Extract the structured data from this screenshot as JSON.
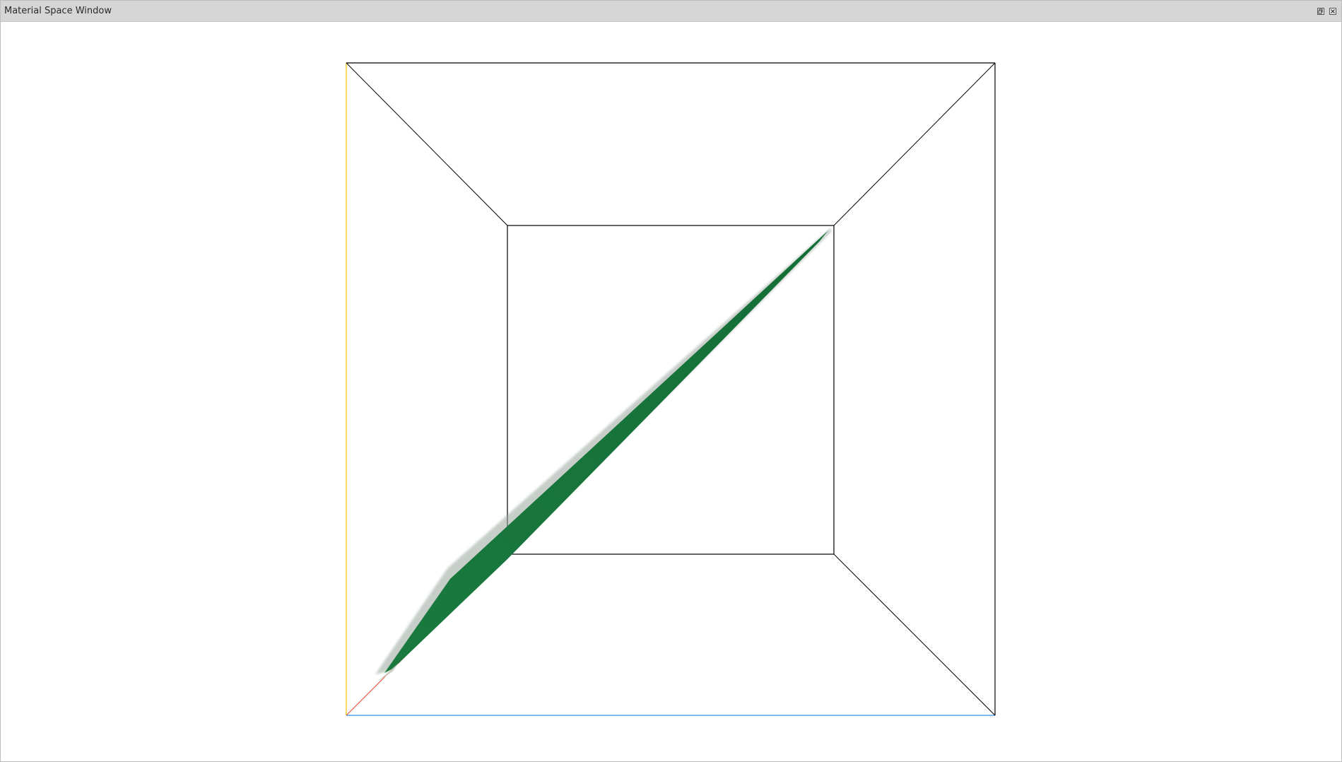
{
  "window": {
    "title": "Material Space Window"
  },
  "title_buttons": {
    "float": {
      "icon": "float-window-icon"
    },
    "close": {
      "icon": "close-icon"
    }
  },
  "viewport": {
    "background": "#ffffff",
    "edge_color": "#000000",
    "axis_colors": {
      "left_vertical": "#f5c400",
      "bottom_horizontal": "#2f8fe6",
      "diagonal": "#e0533a"
    },
    "material_color": "#136e36",
    "material_edge_color": "#9aa79d"
  }
}
